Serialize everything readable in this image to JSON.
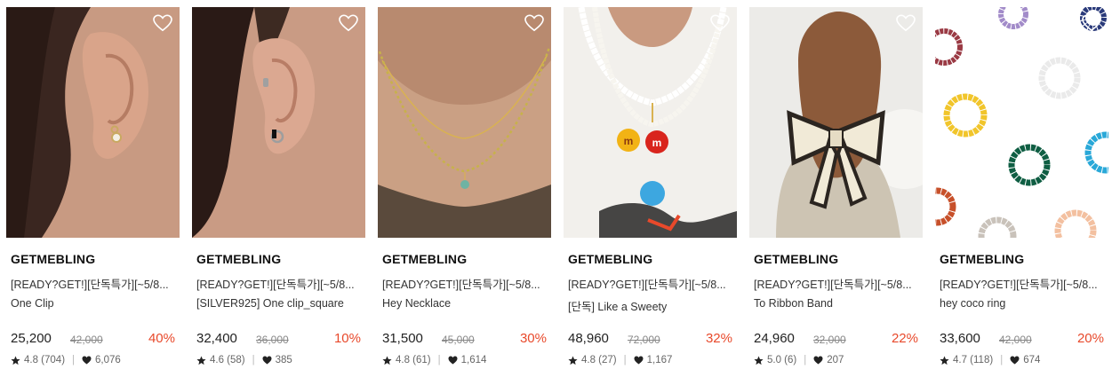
{
  "colors": {
    "discount": "#e8492b",
    "text": "#222222",
    "muted": "#888888"
  },
  "products": [
    {
      "brand": "GETMEBLING",
      "title": "[READY?GET!][단독특가][~5/8...",
      "subtitle": "One Clip",
      "price": "25,200",
      "original_price": "42,000",
      "discount": "40%",
      "rating": "4.8 (704)",
      "likes": "6,076"
    },
    {
      "brand": "GETMEBLING",
      "title": "[READY?GET!][단독특가][~5/8...",
      "subtitle": "[SILVER925] One clip_square",
      "price": "32,400",
      "original_price": "36,000",
      "discount": "10%",
      "rating": "4.6 (58)",
      "likes": "385"
    },
    {
      "brand": "GETMEBLING",
      "title": "[READY?GET!][단독특가][~5/8...",
      "subtitle": "Hey Necklace",
      "price": "31,500",
      "original_price": "45,000",
      "discount": "30%",
      "rating": "4.8 (61)",
      "likes": "1,614"
    },
    {
      "brand": "GETMEBLING",
      "title": "[READY?GET!][단독특가][~5/8...",
      "subtitle": "[단독] Like a Sweety",
      "price": "48,960",
      "original_price": "72,000",
      "discount": "32%",
      "rating": "4.8 (27)",
      "likes": "1,167"
    },
    {
      "brand": "GETMEBLING",
      "title": "[READY?GET!][단독특가][~5/8...",
      "subtitle": "To Ribbon Band",
      "price": "24,960",
      "original_price": "32,000",
      "discount": "22%",
      "rating": "5.0 (6)",
      "likes": "207"
    },
    {
      "brand": "GETMEBLING",
      "title": "[READY?GET!][단독특가][~5/8...",
      "subtitle": "hey coco ring",
      "price": "33,600",
      "original_price": "42,000",
      "discount": "20%",
      "rating": "4.7 (118)",
      "likes": "674"
    }
  ]
}
